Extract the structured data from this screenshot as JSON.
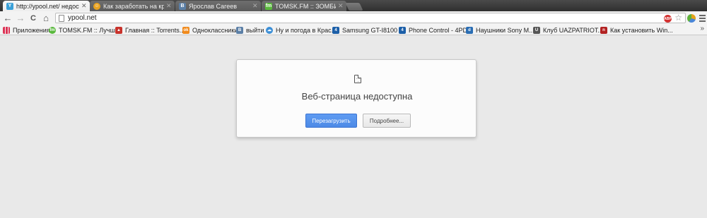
{
  "tabs": [
    {
      "title": "http://ypool.net/ недоступ",
      "favicon": "ypool-icon",
      "active": true
    },
    {
      "title": "Как заработать на крипт",
      "favicon": "smiley-icon",
      "active": false
    },
    {
      "title": "Ярослав Сагеев",
      "favicon": "vk-icon",
      "active": false
    },
    {
      "title": "TOMSK.FM :: ЗОМБИЛАН",
      "favicon": "fm-icon",
      "active": false
    }
  ],
  "toolbar": {
    "back_icon": "←",
    "forward_icon": "→",
    "reload_icon": "C",
    "home_icon": "⌂",
    "url": "ypool.net",
    "star_icon": "☆",
    "adblock_label": "ABP"
  },
  "bookmarks": {
    "items": [
      {
        "label": "Приложения",
        "icon": "apps-grid-icon"
      },
      {
        "label": "TOMSK.FM :: Лучшее",
        "icon": "fm-icon"
      },
      {
        "label": "Главная :: Torrents....",
        "icon": "torrent-icon"
      },
      {
        "label": "Одноклассники",
        "icon": "ok-icon"
      },
      {
        "label": "выйти",
        "icon": "vk-icon"
      },
      {
        "label": "Ну и погода в Крас...",
        "icon": "weather-icon"
      },
      {
        "label": "Samsung GT-I8100 ...",
        "icon": "4pda-icon"
      },
      {
        "label": "Phone Control - 4PDA",
        "icon": "4pda-icon"
      },
      {
        "label": "Наушники Sony M...",
        "icon": "dns-icon"
      },
      {
        "label": "Клуб UAZPATRIOT....",
        "icon": "uaz-icon"
      },
      {
        "label": "Как установить Win...",
        "icon": "news-icon"
      }
    ],
    "more": "»"
  },
  "error": {
    "title": "Веб-страница недоступна",
    "reload_button": "Перезагрузить",
    "details_button": "Подробнее...",
    "face": "˘‸˘"
  },
  "colors": {
    "reload_blue": "#4d8ae6",
    "page_bg": "#e9e9e9"
  }
}
